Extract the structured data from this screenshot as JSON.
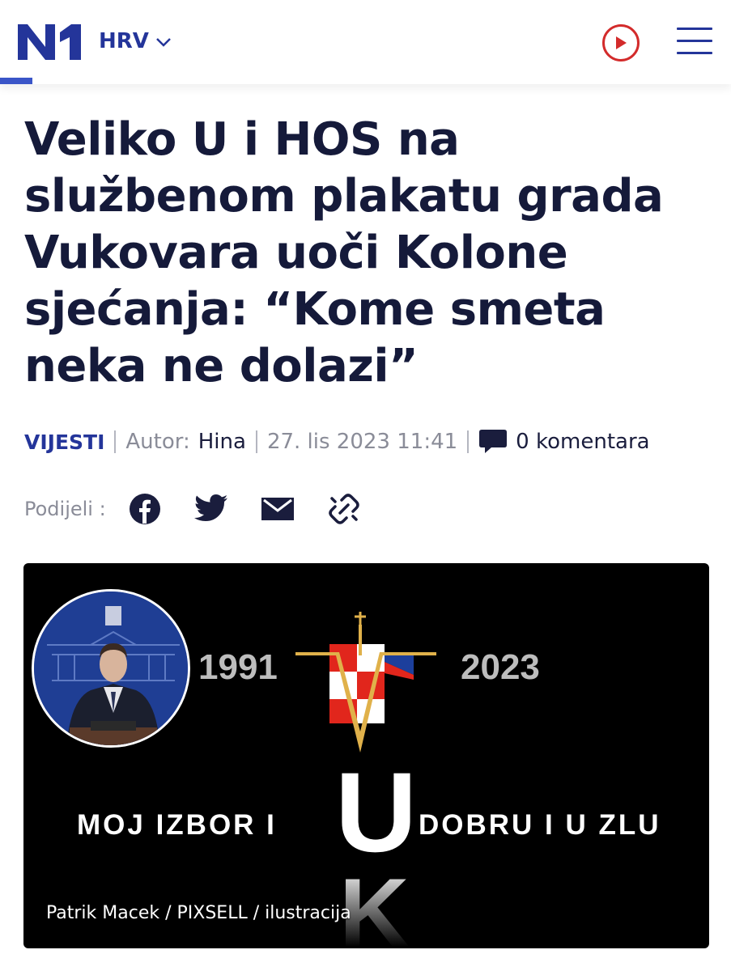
{
  "header": {
    "logo_text": "N1",
    "region_label": "HRV",
    "play_icon": "play-circle-icon",
    "menu_icon": "hamburger-menu-icon",
    "accent_color": "#24359a",
    "play_color": "#d32b2b"
  },
  "article": {
    "title": "Veliko U i HOS na službenom plakatu grada Vukovara uoči Kolone sjećanja: “Kome smeta neka ne dolazi”",
    "category": "VIJESTI",
    "author_label": "Autor:",
    "author": "Hina",
    "date": "27. lis 2023 11:41",
    "comments": "0 komentara"
  },
  "share": {
    "label": "Podijeli :",
    "icons": [
      "facebook-icon",
      "twitter-icon",
      "email-icon",
      "link-icon"
    ]
  },
  "hero": {
    "year_left": "1991",
    "year_right": "2023",
    "slogan_left": "MOJ IZBOR I",
    "letter_u": "U",
    "slogan_right": "DOBRU I U ZLU",
    "letter_k": "K",
    "caption": "Patrik Macek / PIXSELL / ilustracija"
  }
}
